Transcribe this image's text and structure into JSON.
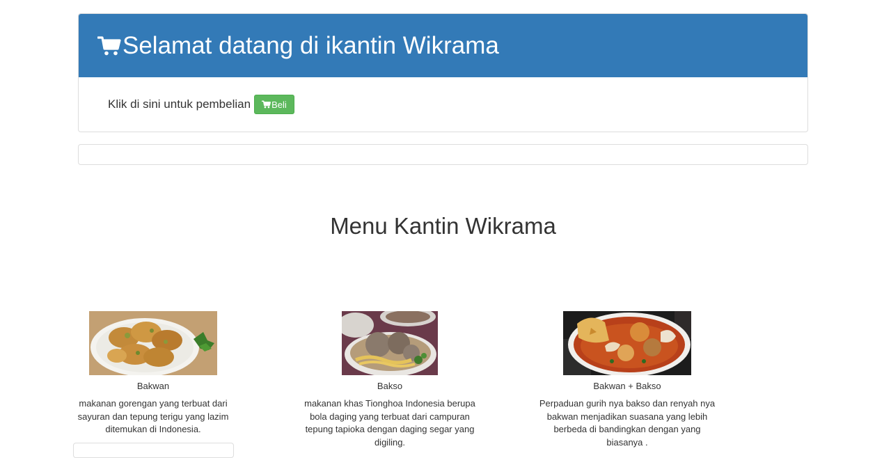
{
  "header": {
    "title": "Selamat datang di ikantin Wikrama",
    "cart_icon": "cart-icon",
    "bg_color": "#337ab7"
  },
  "purchase": {
    "text": "Klik di sini untuk pembelian",
    "button_label": "Beli",
    "button_color": "#5cb85c"
  },
  "menu": {
    "title": "Menu Kantin Wikrama",
    "items": [
      {
        "name": "Bakwan",
        "description": "makanan gorengan yang terbuat dari sayuran dan tepung terigu yang lazim ditemukan di Indonesia."
      },
      {
        "name": "Bakso",
        "description": "makanan khas Tionghoa Indonesia berupa bola daging yang terbuat dari campuran tepung tapioka dengan daging segar yang digiling."
      },
      {
        "name": "Bakwan + Bakso",
        "description": "Perpaduan gurih nya bakso dan renyah nya bakwan menjadikan suasana yang lebih berbeda di bandingkan dengan yang biasanya ."
      }
    ]
  }
}
